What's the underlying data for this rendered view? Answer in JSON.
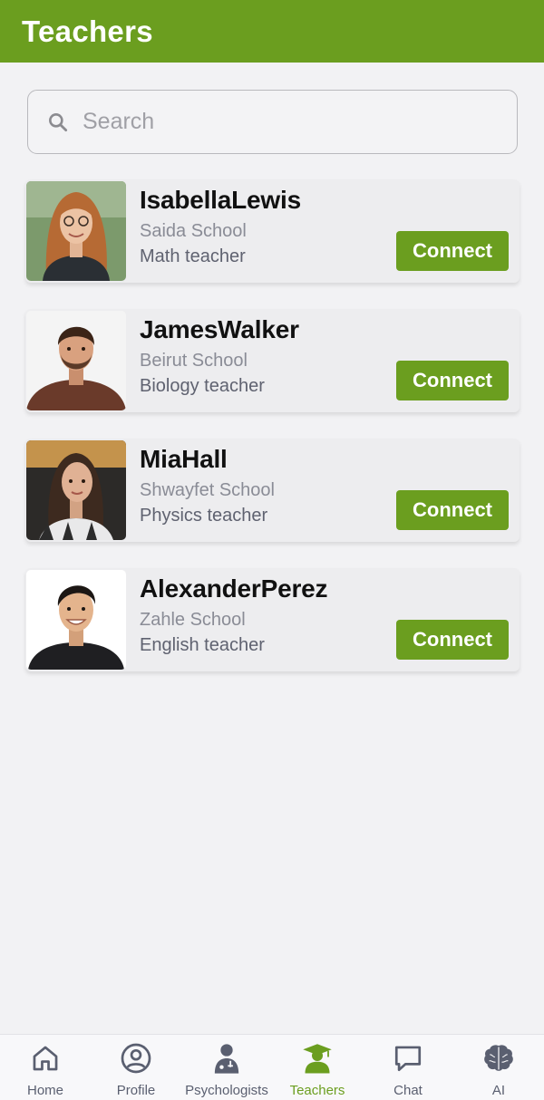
{
  "header": {
    "title": "Teachers"
  },
  "search": {
    "placeholder": "Search",
    "value": ""
  },
  "teachers": [
    {
      "name": "IsabellaLewis",
      "school": "Saida School",
      "subject": "Math teacher",
      "action": "Connect"
    },
    {
      "name": "JamesWalker",
      "school": "Beirut School",
      "subject": "Biology teacher",
      "action": "Connect"
    },
    {
      "name": "MiaHall",
      "school": "Shwayfet School",
      "subject": "Physics teacher",
      "action": "Connect"
    },
    {
      "name": "AlexanderPerez",
      "school": "Zahle School",
      "subject": "English teacher",
      "action": "Connect"
    }
  ],
  "nav": {
    "items": [
      {
        "label": "Home",
        "icon": "home-icon"
      },
      {
        "label": "Profile",
        "icon": "profile-icon"
      },
      {
        "label": "Psychologists",
        "icon": "doctor-icon"
      },
      {
        "label": "Teachers",
        "icon": "graduate-icon",
        "active": true
      },
      {
        "label": "Chat",
        "icon": "chat-icon"
      },
      {
        "label": "AI",
        "icon": "brain-icon"
      }
    ]
  },
  "colors": {
    "primary": "#6b9e1f",
    "background": "#f2f2f4",
    "nav_inactive": "#5a5f70"
  }
}
